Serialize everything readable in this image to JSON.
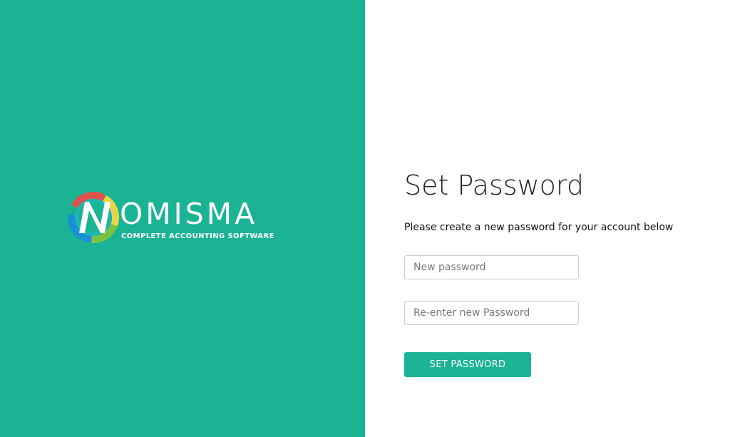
{
  "brand": {
    "name": "NOMISMA",
    "word": "OMISMA",
    "tagline": "COMPLETE ACCOUNTING SOFTWARE",
    "logo_icon": "nomisma-logo-mark",
    "colors": {
      "panel": "#1ab394",
      "ring_red": "#d9534f",
      "ring_yellow": "#e3d64a",
      "ring_green": "#7cc242",
      "ring_blue": "#1b8fd6",
      "ring_teal": "#21b8c9"
    }
  },
  "form": {
    "title": "Set Password",
    "subtitle": "Please create a new password for your account below",
    "new_password": {
      "value": "",
      "placeholder": "New password"
    },
    "confirm_password": {
      "value": "",
      "placeholder": "Re-enter new Password"
    },
    "submit_label": "SET PASSWORD"
  }
}
